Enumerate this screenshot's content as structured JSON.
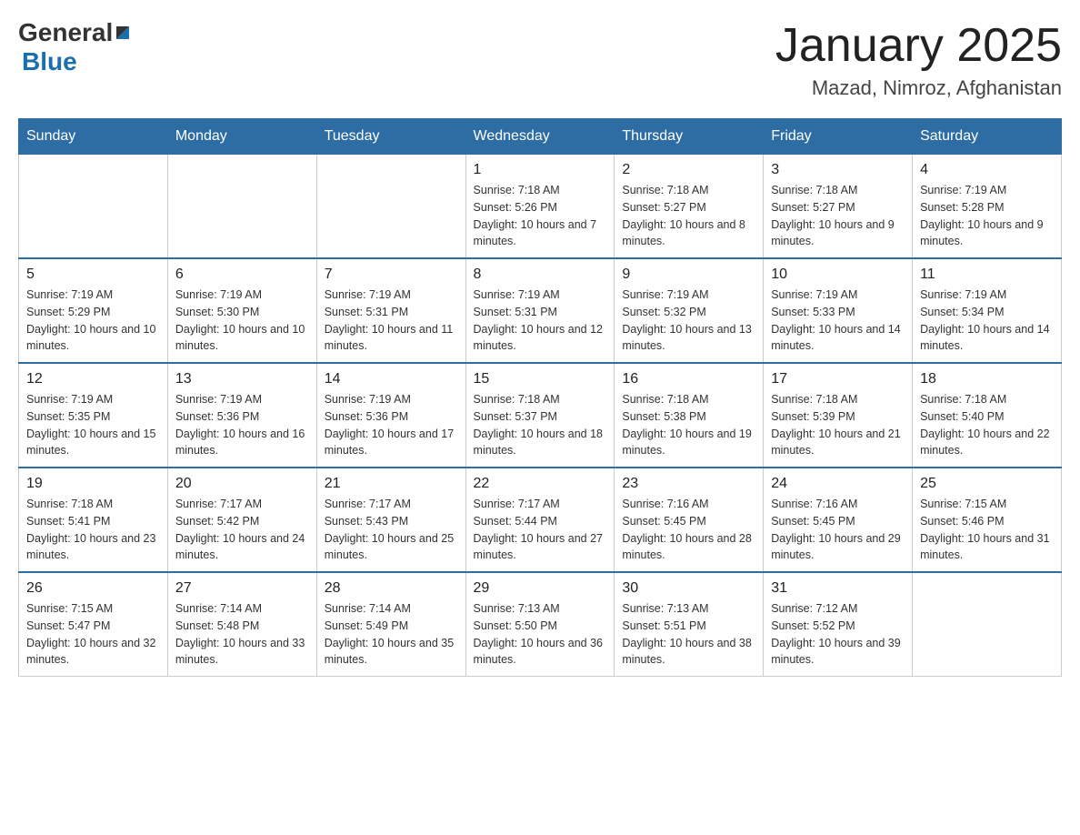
{
  "header": {
    "logo_general": "General",
    "logo_blue": "Blue",
    "month_title": "January 2025",
    "location": "Mazad, Nimroz, Afghanistan"
  },
  "days_of_week": [
    "Sunday",
    "Monday",
    "Tuesday",
    "Wednesday",
    "Thursday",
    "Friday",
    "Saturday"
  ],
  "weeks": [
    [
      {
        "day": "",
        "info": ""
      },
      {
        "day": "",
        "info": ""
      },
      {
        "day": "",
        "info": ""
      },
      {
        "day": "1",
        "info": "Sunrise: 7:18 AM\nSunset: 5:26 PM\nDaylight: 10 hours and 7 minutes."
      },
      {
        "day": "2",
        "info": "Sunrise: 7:18 AM\nSunset: 5:27 PM\nDaylight: 10 hours and 8 minutes."
      },
      {
        "day": "3",
        "info": "Sunrise: 7:18 AM\nSunset: 5:27 PM\nDaylight: 10 hours and 9 minutes."
      },
      {
        "day": "4",
        "info": "Sunrise: 7:19 AM\nSunset: 5:28 PM\nDaylight: 10 hours and 9 minutes."
      }
    ],
    [
      {
        "day": "5",
        "info": "Sunrise: 7:19 AM\nSunset: 5:29 PM\nDaylight: 10 hours and 10 minutes."
      },
      {
        "day": "6",
        "info": "Sunrise: 7:19 AM\nSunset: 5:30 PM\nDaylight: 10 hours and 10 minutes."
      },
      {
        "day": "7",
        "info": "Sunrise: 7:19 AM\nSunset: 5:31 PM\nDaylight: 10 hours and 11 minutes."
      },
      {
        "day": "8",
        "info": "Sunrise: 7:19 AM\nSunset: 5:31 PM\nDaylight: 10 hours and 12 minutes."
      },
      {
        "day": "9",
        "info": "Sunrise: 7:19 AM\nSunset: 5:32 PM\nDaylight: 10 hours and 13 minutes."
      },
      {
        "day": "10",
        "info": "Sunrise: 7:19 AM\nSunset: 5:33 PM\nDaylight: 10 hours and 14 minutes."
      },
      {
        "day": "11",
        "info": "Sunrise: 7:19 AM\nSunset: 5:34 PM\nDaylight: 10 hours and 14 minutes."
      }
    ],
    [
      {
        "day": "12",
        "info": "Sunrise: 7:19 AM\nSunset: 5:35 PM\nDaylight: 10 hours and 15 minutes."
      },
      {
        "day": "13",
        "info": "Sunrise: 7:19 AM\nSunset: 5:36 PM\nDaylight: 10 hours and 16 minutes."
      },
      {
        "day": "14",
        "info": "Sunrise: 7:19 AM\nSunset: 5:36 PM\nDaylight: 10 hours and 17 minutes."
      },
      {
        "day": "15",
        "info": "Sunrise: 7:18 AM\nSunset: 5:37 PM\nDaylight: 10 hours and 18 minutes."
      },
      {
        "day": "16",
        "info": "Sunrise: 7:18 AM\nSunset: 5:38 PM\nDaylight: 10 hours and 19 minutes."
      },
      {
        "day": "17",
        "info": "Sunrise: 7:18 AM\nSunset: 5:39 PM\nDaylight: 10 hours and 21 minutes."
      },
      {
        "day": "18",
        "info": "Sunrise: 7:18 AM\nSunset: 5:40 PM\nDaylight: 10 hours and 22 minutes."
      }
    ],
    [
      {
        "day": "19",
        "info": "Sunrise: 7:18 AM\nSunset: 5:41 PM\nDaylight: 10 hours and 23 minutes."
      },
      {
        "day": "20",
        "info": "Sunrise: 7:17 AM\nSunset: 5:42 PM\nDaylight: 10 hours and 24 minutes."
      },
      {
        "day": "21",
        "info": "Sunrise: 7:17 AM\nSunset: 5:43 PM\nDaylight: 10 hours and 25 minutes."
      },
      {
        "day": "22",
        "info": "Sunrise: 7:17 AM\nSunset: 5:44 PM\nDaylight: 10 hours and 27 minutes."
      },
      {
        "day": "23",
        "info": "Sunrise: 7:16 AM\nSunset: 5:45 PM\nDaylight: 10 hours and 28 minutes."
      },
      {
        "day": "24",
        "info": "Sunrise: 7:16 AM\nSunset: 5:45 PM\nDaylight: 10 hours and 29 minutes."
      },
      {
        "day": "25",
        "info": "Sunrise: 7:15 AM\nSunset: 5:46 PM\nDaylight: 10 hours and 31 minutes."
      }
    ],
    [
      {
        "day": "26",
        "info": "Sunrise: 7:15 AM\nSunset: 5:47 PM\nDaylight: 10 hours and 32 minutes."
      },
      {
        "day": "27",
        "info": "Sunrise: 7:14 AM\nSunset: 5:48 PM\nDaylight: 10 hours and 33 minutes."
      },
      {
        "day": "28",
        "info": "Sunrise: 7:14 AM\nSunset: 5:49 PM\nDaylight: 10 hours and 35 minutes."
      },
      {
        "day": "29",
        "info": "Sunrise: 7:13 AM\nSunset: 5:50 PM\nDaylight: 10 hours and 36 minutes."
      },
      {
        "day": "30",
        "info": "Sunrise: 7:13 AM\nSunset: 5:51 PM\nDaylight: 10 hours and 38 minutes."
      },
      {
        "day": "31",
        "info": "Sunrise: 7:12 AM\nSunset: 5:52 PM\nDaylight: 10 hours and 39 minutes."
      },
      {
        "day": "",
        "info": ""
      }
    ]
  ]
}
